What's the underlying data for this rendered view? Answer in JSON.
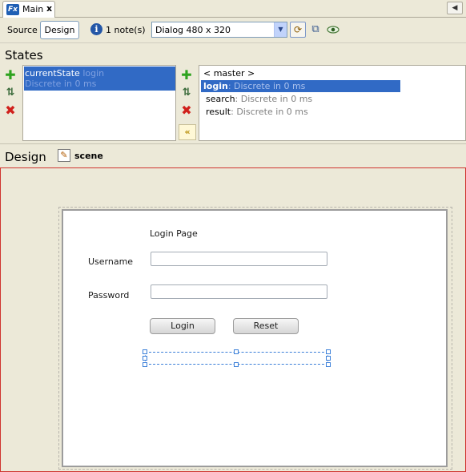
{
  "tab": {
    "label": "Main",
    "close": "x",
    "icon": "Fx"
  },
  "toolbar": {
    "source_label": "Source",
    "design_label": "Design",
    "notes_label": "1 note(s)",
    "device_value": "Dialog 480 x 320"
  },
  "states": {
    "title": "States",
    "current": {
      "name": "currentState",
      "value": "login",
      "transition": "Discrete in 0 ms"
    },
    "transitions": [
      {
        "name": "< master >",
        "detail": ""
      },
      {
        "name": "login",
        "detail": ": Discrete in 0 ms"
      },
      {
        "name": "search",
        "detail": ": Discrete in 0 ms"
      },
      {
        "name": "result",
        "detail": ": Discrete in 0 ms"
      }
    ],
    "selected_transition": "login"
  },
  "design": {
    "title": "Design",
    "scene_label": "scene",
    "form": {
      "title": "Login Page",
      "username_label": "Username",
      "password_label": "Password",
      "login_button": "Login",
      "reset_button": "Reset"
    }
  },
  "colors": {
    "selection": "#316ac5",
    "canvas_border": "#d0352f",
    "add": "#2ea31f",
    "delete": "#d0201b"
  }
}
